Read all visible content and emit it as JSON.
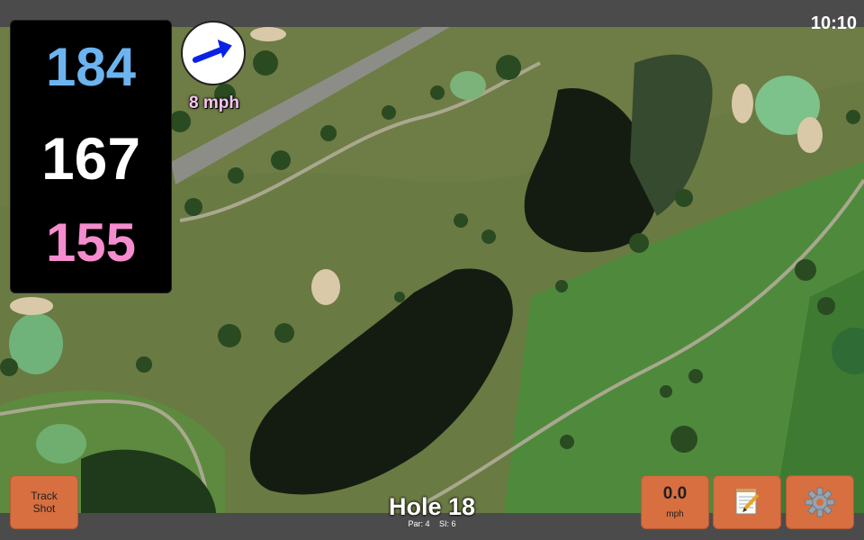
{
  "clock": "10:10",
  "distances": {
    "back": "184",
    "middle": "167",
    "front": "155"
  },
  "wind": {
    "speed": "8 mph",
    "icon": "wind-arrow-icon",
    "color": "#0a22e6"
  },
  "track_shot": {
    "label": "Track Shot"
  },
  "shot_speed": {
    "value": "0.0",
    "unit": "mph"
  },
  "notes": {
    "icon": "notepad-icon"
  },
  "settings": {
    "icon": "gear-icon"
  },
  "hole": {
    "title": "Hole 18",
    "par": "Par: 4",
    "si": "SI: 6"
  },
  "colors": {
    "back": "#6cb4f0",
    "middle": "#ffffff",
    "front": "#f58ccd",
    "button": "#d76f40"
  }
}
